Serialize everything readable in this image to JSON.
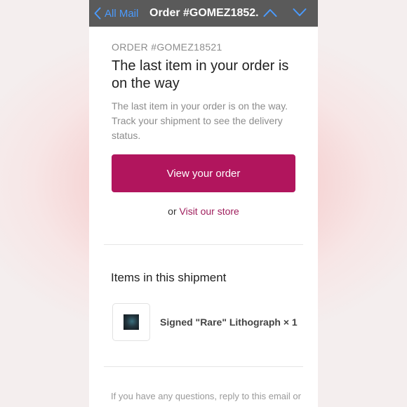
{
  "navbar": {
    "back_label": "All Mail",
    "title": "Order #GOMEZ1852..."
  },
  "email": {
    "order_label": "ORDER #GOMEZ18521",
    "headline": "The last item in your order is on the way",
    "description": "The last item in your order is on the way. Track your shipment to see the delivery status.",
    "cta_label": "View your order",
    "or_text": "or",
    "store_link": "Visit our store",
    "section_title": "Items in this shipment",
    "items": [
      {
        "name": "Signed \"Rare\" Lithograph × 1"
      }
    ],
    "footer": "If you have any questions, reply to this email or"
  },
  "colors": {
    "accent": "#b1155d",
    "link": "#a0205e",
    "nav_link": "#4a9bff",
    "nav_bg": "#5a5a5a"
  }
}
